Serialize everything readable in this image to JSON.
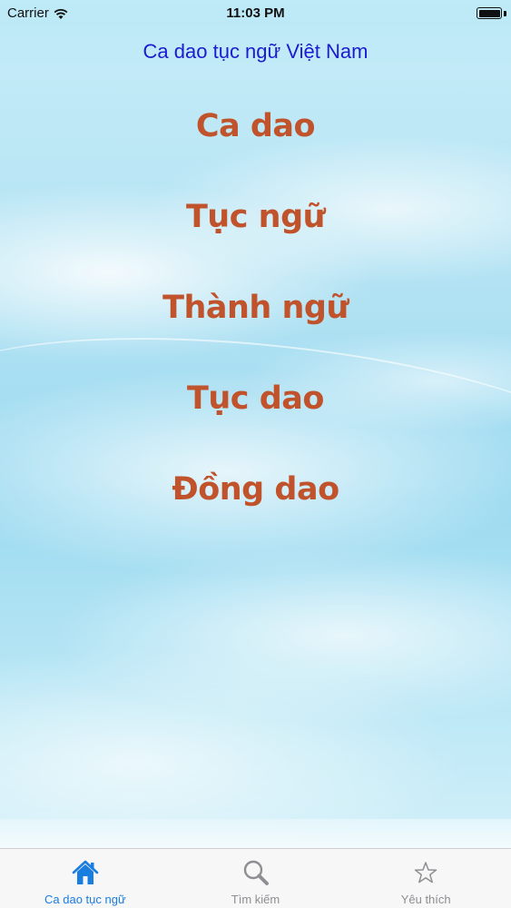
{
  "status_bar": {
    "carrier": "Carrier",
    "time": "11:03 PM",
    "battery_level_percent": 100,
    "icons": [
      "wifi-icon",
      "battery-icon"
    ]
  },
  "nav_bar": {
    "title": "Ca dao tục ngữ Việt Nam"
  },
  "menu": {
    "items": [
      {
        "label": "Ca dao"
      },
      {
        "label": "Tục ngữ"
      },
      {
        "label": "Thành ngữ"
      },
      {
        "label": "Tục dao"
      },
      {
        "label": "Đồng dao"
      }
    ]
  },
  "tab_bar": {
    "tabs": [
      {
        "label": "Ca dao tục ngữ",
        "icon": "home-icon",
        "active": true
      },
      {
        "label": "Tìm kiếm",
        "icon": "search-icon",
        "active": false
      },
      {
        "label": "Yêu thích",
        "icon": "star-icon",
        "active": false
      }
    ]
  },
  "colors": {
    "nav_title": "#1b1ccf",
    "menu_text": "#c0532b",
    "tab_active": "#1a7de0",
    "tab_inactive": "#8e8e93"
  }
}
